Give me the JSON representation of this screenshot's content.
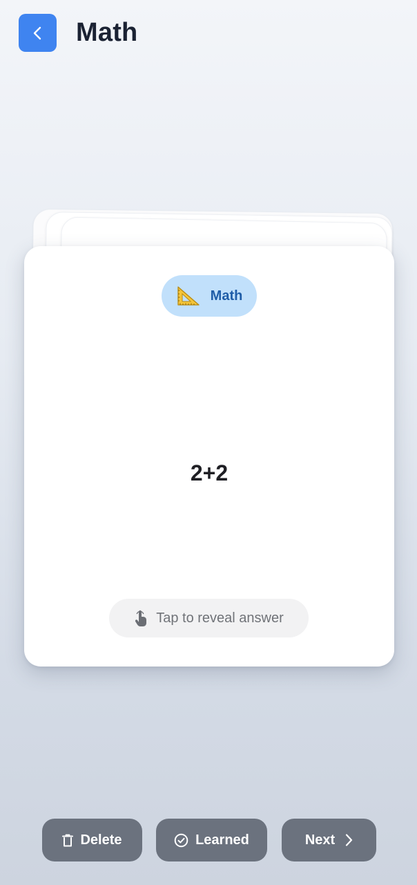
{
  "header": {
    "title": "Math",
    "back_icon": "chevron-left-icon"
  },
  "card": {
    "category": {
      "label": "Math",
      "icon": "triangular-ruler-icon"
    },
    "question": "2+2",
    "reveal": {
      "label": "Tap to reveal answer",
      "icon": "tap-hand-icon"
    }
  },
  "actions": {
    "delete_label": "Delete",
    "learned_label": "Learned",
    "next_label": "Next"
  },
  "colors": {
    "accent": "#3f84f0",
    "chip_bg": "#c1e0fb",
    "chip_text": "#1f5da8",
    "action_bg": "#6b727e"
  }
}
